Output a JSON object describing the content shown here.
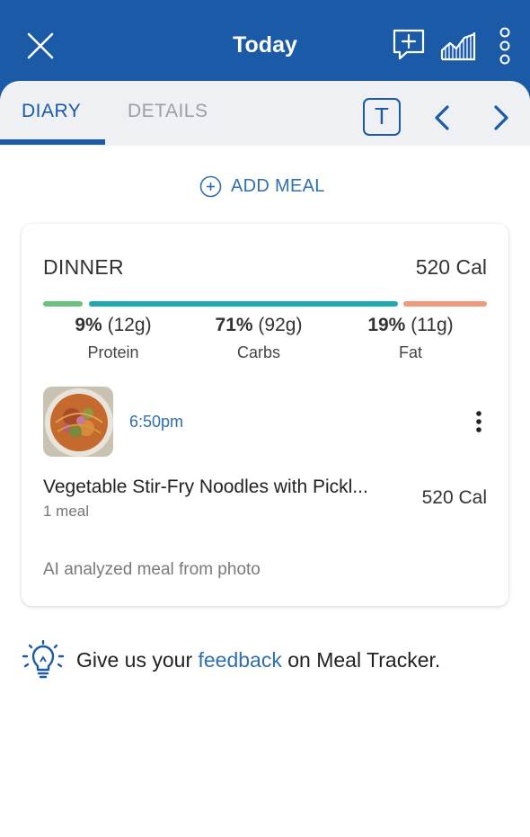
{
  "header": {
    "title": "Today",
    "close_icon": "close-icon",
    "chat_icon": "add-comment-icon",
    "chart_icon": "trend-chart-icon",
    "more_icon": "more-vertical-icon",
    "background": "#1a5aa6"
  },
  "tabs": {
    "diary": "DIARY",
    "details": "DETAILS",
    "today_button": "T",
    "prev_icon": "chevron-left-icon",
    "next_icon": "chevron-right-icon",
    "active": "DIARY"
  },
  "add_meal": {
    "label": "ADD MEAL",
    "icon": "add-circle-icon"
  },
  "meal": {
    "name": "DINNER",
    "calories": "520 Cal",
    "macros": [
      {
        "percent": "9%",
        "grams": "(12g)",
        "name": "Protein",
        "color": "#6cc17f"
      },
      {
        "percent": "71%",
        "grams": "(92g)",
        "name": "Carbs",
        "color": "#20aab0"
      },
      {
        "percent": "19%",
        "grams": "(11g)",
        "name": "Fat",
        "color": "#ef9a7c"
      }
    ],
    "entry": {
      "time": "6:50pm",
      "food_name": "Vegetable Stir-Fry Noodles with Pickl...",
      "quantity": "1 meal",
      "calories": "520 Cal",
      "photo": "meal-photo",
      "more_icon": "more-vertical-icon"
    },
    "note": "AI analyzed meal from photo"
  },
  "feedback": {
    "icon": "lightbulb-icon",
    "prefix": "Give us your ",
    "link": "feedback",
    "suffix": " on Meal Tracker."
  },
  "colors": {
    "accent": "#1a5aa6",
    "link": "#2f6fb0"
  }
}
